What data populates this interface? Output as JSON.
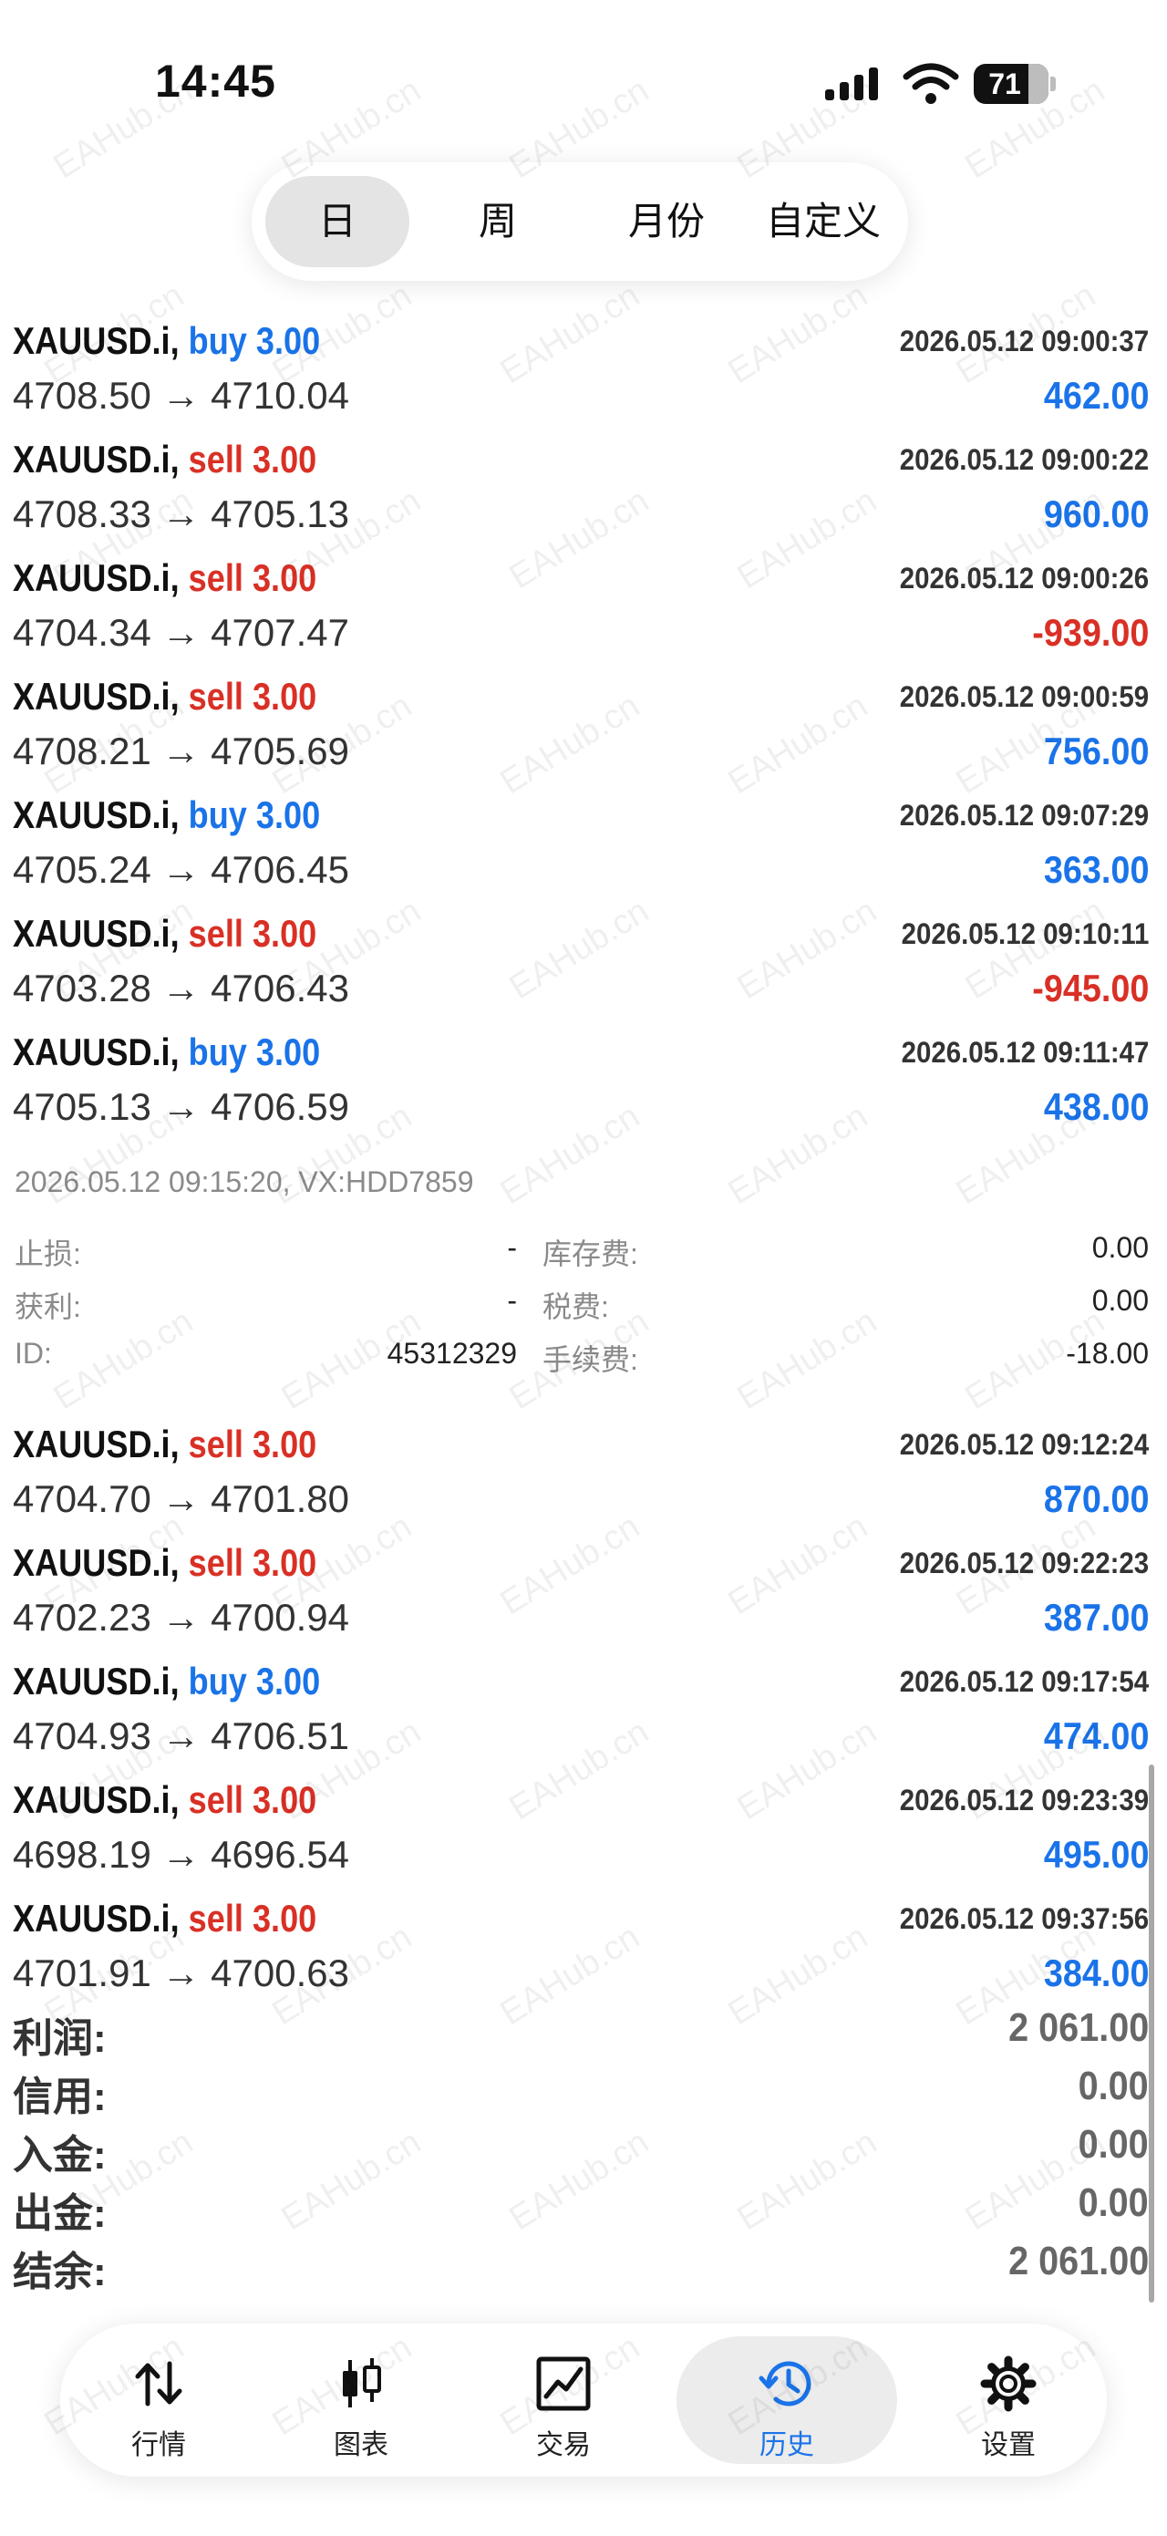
{
  "status_bar": {
    "time": "14:45",
    "battery": "71"
  },
  "period_tabs": [
    {
      "label": "日",
      "active": true
    },
    {
      "label": "周",
      "active": false
    },
    {
      "label": "月份",
      "active": false
    },
    {
      "label": "自定义",
      "active": false
    }
  ],
  "trades_top": [
    {
      "symbol": "XAUUSD.i,",
      "type": "buy",
      "volume": "3.00",
      "time": "2026.05.12 09:00:37",
      "open": "4708.50",
      "close": "4710.04",
      "profit": "462.00"
    },
    {
      "symbol": "XAUUSD.i,",
      "type": "sell",
      "volume": "3.00",
      "time": "2026.05.12 09:00:22",
      "open": "4708.33",
      "close": "4705.13",
      "profit": "960.00"
    },
    {
      "symbol": "XAUUSD.i,",
      "type": "sell",
      "volume": "3.00",
      "time": "2026.05.12 09:00:26",
      "open": "4704.34",
      "close": "4707.47",
      "profit": "-939.00"
    },
    {
      "symbol": "XAUUSD.i,",
      "type": "sell",
      "volume": "3.00",
      "time": "2026.05.12 09:00:59",
      "open": "4708.21",
      "close": "4705.69",
      "profit": "756.00"
    },
    {
      "symbol": "XAUUSD.i,",
      "type": "buy",
      "volume": "3.00",
      "time": "2026.05.12 09:07:29",
      "open": "4705.24",
      "close": "4706.45",
      "profit": "363.00"
    },
    {
      "symbol": "XAUUSD.i,",
      "type": "sell",
      "volume": "3.00",
      "time": "2026.05.12 09:10:11",
      "open": "4703.28",
      "close": "4706.43",
      "profit": "-945.00"
    },
    {
      "symbol": "XAUUSD.i,",
      "type": "buy",
      "volume": "3.00",
      "time": "2026.05.12 09:11:47",
      "open": "4705.13",
      "close": "4706.59",
      "profit": "438.00"
    }
  ],
  "expanded": {
    "close_time": "2026.05.12 09:15:20, VX:HDD7859",
    "sl_label": "止损:",
    "sl_value": "-",
    "tp_label": "获利:",
    "tp_value": "-",
    "id_label": "ID:",
    "id_value": "45312329",
    "swap_label": "库存费:",
    "swap_value": "0.00",
    "tax_label": "税费:",
    "tax_value": "0.00",
    "commission_label": "手续费:",
    "commission_value": "-18.00"
  },
  "trades_bottom": [
    {
      "symbol": "XAUUSD.i,",
      "type": "sell",
      "volume": "3.00",
      "time": "2026.05.12 09:12:24",
      "open": "4704.70",
      "close": "4701.80",
      "profit": "870.00"
    },
    {
      "symbol": "XAUUSD.i,",
      "type": "sell",
      "volume": "3.00",
      "time": "2026.05.12 09:22:23",
      "open": "4702.23",
      "close": "4700.94",
      "profit": "387.00"
    },
    {
      "symbol": "XAUUSD.i,",
      "type": "buy",
      "volume": "3.00",
      "time": "2026.05.12 09:17:54",
      "open": "4704.93",
      "close": "4706.51",
      "profit": "474.00"
    },
    {
      "symbol": "XAUUSD.i,",
      "type": "sell",
      "volume": "3.00",
      "time": "2026.05.12 09:23:39",
      "open": "4698.19",
      "close": "4696.54",
      "profit": "495.00"
    },
    {
      "symbol": "XAUUSD.i,",
      "type": "sell",
      "volume": "3.00",
      "time": "2026.05.12 09:37:56",
      "open": "4701.91",
      "close": "4700.63",
      "profit": "384.00"
    }
  ],
  "price_arrow": "→",
  "summary": [
    {
      "label": "利润:",
      "value": "2 061.00"
    },
    {
      "label": "信用:",
      "value": "0.00"
    },
    {
      "label": "入金:",
      "value": "0.00"
    },
    {
      "label": "出金:",
      "value": "0.00"
    },
    {
      "label": "结余:",
      "value": "2 061.00"
    }
  ],
  "bottom_nav": [
    {
      "label": "行情",
      "icon": "arrows-up-down-icon",
      "active": false
    },
    {
      "label": "图表",
      "icon": "candlestick-icon",
      "active": false
    },
    {
      "label": "交易",
      "icon": "trade-chart-icon",
      "active": false
    },
    {
      "label": "历史",
      "icon": "history-clock-icon",
      "active": true
    },
    {
      "label": "设置",
      "icon": "gear-icon",
      "active": false
    }
  ],
  "colors": {
    "buy": "#1a73e8",
    "sell": "#d93025",
    "active_tab": "#1a73e8"
  },
  "watermark": "EAHub.cn"
}
